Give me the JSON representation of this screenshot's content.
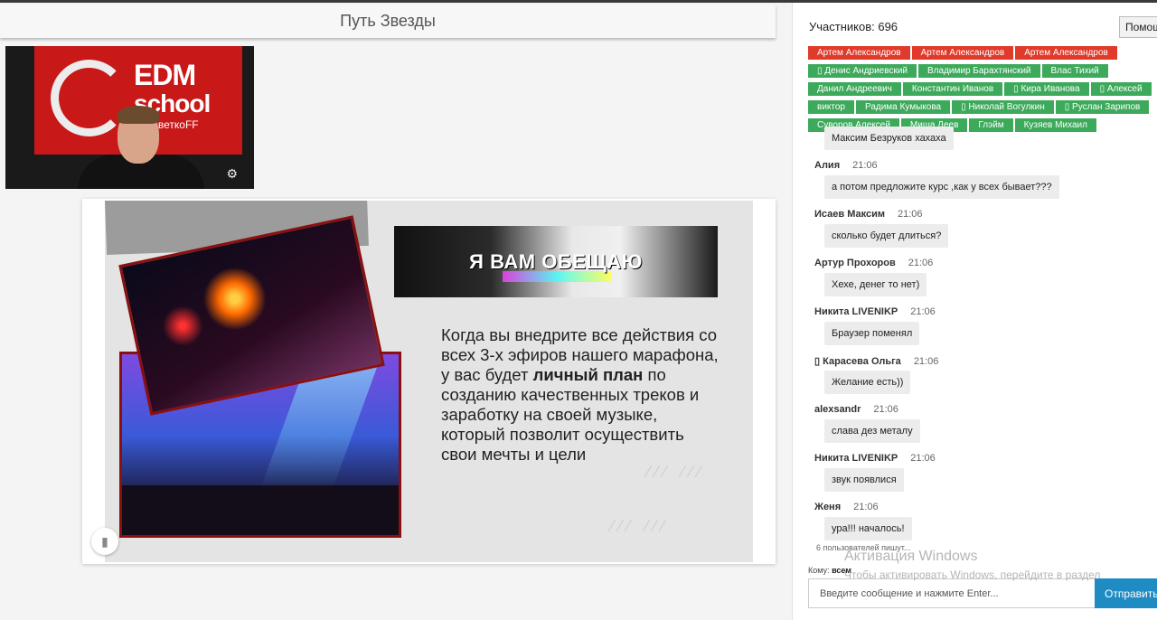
{
  "title": "Путь Звезды",
  "video": {
    "logo_line1": "EDM",
    "logo_line2": "school",
    "logo_line3": "DJ ЦветкоFF",
    "settings_icon": "gear-icon"
  },
  "slide": {
    "banner": "Я ВАМ ОБЕЩАЮ",
    "text_before": "Когда вы внедрите все действия со всех 3-х эфиров нашего марафона, у вас будет ",
    "text_bold": "личный план",
    "text_after": " по созданию качественных треков и заработку на своей музыке, который позволит осуществить свои мечты и цели",
    "bookmark_icon": "bookmark-icon"
  },
  "panel": {
    "participants": "Участников: 696",
    "help_label": "Помощь",
    "tags": [
      {
        "label": "Артем Александров",
        "color": "red"
      },
      {
        "label": "Артем Александров",
        "color": "red"
      },
      {
        "label": "Артем Александров",
        "color": "red"
      },
      {
        "label": "▯ Денис Андриевский",
        "color": "green"
      },
      {
        "label": "Владимир Барахтянский",
        "color": "green"
      },
      {
        "label": "Влас Тихий",
        "color": "green"
      },
      {
        "label": "Данил Андреевич",
        "color": "green"
      },
      {
        "label": "Константин Иванов",
        "color": "green"
      },
      {
        "label": "▯ Кира Иванова",
        "color": "green"
      },
      {
        "label": "▯ Алексей",
        "color": "green"
      },
      {
        "label": "виктор",
        "color": "green"
      },
      {
        "label": "Радима Кумыкова",
        "color": "green"
      },
      {
        "label": "▯ Николай Вогулкин",
        "color": "green"
      },
      {
        "label": "▯ Руслан Зарипов",
        "color": "green"
      },
      {
        "label": "Суворов Алексей",
        "color": "green"
      },
      {
        "label": "Миша Деев",
        "color": "green"
      },
      {
        "label": "Глэйм",
        "color": "green"
      },
      {
        "label": "Кузяев Михаил",
        "color": "green"
      }
    ],
    "messages": [
      {
        "author": "",
        "time": "",
        "text": "Максим Безруков хахаха"
      },
      {
        "author": "Алия",
        "time": "21:06",
        "text": "а потом предложите курс ,как у всех бывает???"
      },
      {
        "author": "Исаев Максим",
        "time": "21:06",
        "text": "сколько будет длиться?"
      },
      {
        "author": "Артур Прохоров",
        "time": "21:06",
        "text": "Хехе, денег то нет)"
      },
      {
        "author": "Никита LIVENIKP",
        "time": "21:06",
        "text": "Браузер поменял"
      },
      {
        "author": "▯ Карасева Ольга",
        "time": "21:06",
        "text": "Желание есть))"
      },
      {
        "author": "alexsandr",
        "time": "21:06",
        "text": "слава дез металу"
      },
      {
        "author": "Никита LIVENIKP",
        "time": "21:06",
        "text": "звук появлися"
      },
      {
        "author": "Женя",
        "time": "21:06",
        "text": "ура!!! началось!"
      }
    ],
    "typing": "6 пользователей пишут...",
    "to_label": "Кому:",
    "to_value": "всем",
    "input_placeholder": "Введите сообщение и нажмите Enter...",
    "send_label": "Отправить",
    "watermark_title": "Активация Windows",
    "watermark_text": "Чтобы активировать Windows, перейдите в раздел"
  }
}
